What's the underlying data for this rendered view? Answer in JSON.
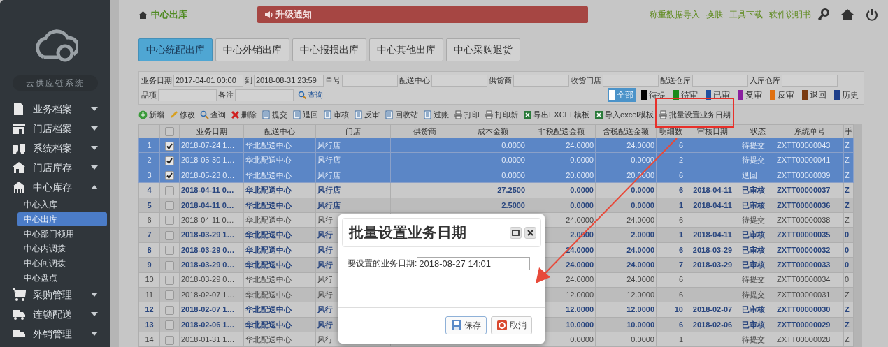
{
  "sidebar": {
    "title": "云供应链系统",
    "items": [
      {
        "label": "业务档案",
        "expanded": false
      },
      {
        "label": "门店档案",
        "expanded": false
      },
      {
        "label": "系统档案",
        "expanded": false
      },
      {
        "label": "门店库存",
        "expanded": false
      },
      {
        "label": "中心库存",
        "expanded": true,
        "children": [
          {
            "label": "中心入库",
            "selected": false
          },
          {
            "label": "中心出库",
            "selected": true
          },
          {
            "label": "中心部门领用",
            "selected": false
          },
          {
            "label": "中心内调拨",
            "selected": false
          },
          {
            "label": "中心间调拨",
            "selected": false
          },
          {
            "label": "中心盘点",
            "selected": false
          }
        ]
      },
      {
        "label": "采购管理",
        "expanded": false
      },
      {
        "label": "连锁配送",
        "expanded": false
      },
      {
        "label": "外销管理",
        "expanded": false
      }
    ]
  },
  "header": {
    "title": "中心出库",
    "notice": "升级通知",
    "links": [
      "称重数据导入",
      "换肤",
      "工具下载",
      "软件说明书"
    ]
  },
  "tabs": [
    {
      "label": "中心统配出库",
      "selected": true
    },
    {
      "label": "中心外销出库",
      "selected": false
    },
    {
      "label": "中心报损出库",
      "selected": false
    },
    {
      "label": "中心其他出库",
      "selected": false
    },
    {
      "label": "中心采购退货",
      "selected": false
    }
  ],
  "filters": {
    "fields": [
      {
        "label": "业务日期",
        "value": "2017-04-01 00:00"
      },
      {
        "label": "到",
        "value": "2018-08-31 23:59"
      },
      {
        "label": "单号"
      },
      {
        "label": "配送中心"
      },
      {
        "label": "供货商"
      },
      {
        "label": "收货门店"
      },
      {
        "label": "配送仓库"
      },
      {
        "label": "入库仓库"
      }
    ],
    "fields_2": [
      {
        "label": "品项"
      },
      {
        "label": "备注"
      }
    ],
    "query_button": "查询",
    "status_legend": [
      {
        "label": "全部",
        "color": "#ffffff",
        "selected": true
      },
      {
        "label": "待提",
        "color": "#000000",
        "selected": false
      },
      {
        "label": "待审",
        "color": "#1a8a1a",
        "selected": false
      },
      {
        "label": "已审",
        "color": "#1f4fa0",
        "selected": false
      },
      {
        "label": "复审",
        "color": "#8a1fa0",
        "selected": false
      },
      {
        "label": "反审",
        "color": "#e07010",
        "selected": false
      },
      {
        "label": "退回",
        "color": "#7a3a10",
        "selected": false
      },
      {
        "label": "历史",
        "color": "#1f3f8a",
        "selected": false
      }
    ]
  },
  "toolbar": [
    "新增",
    "修改",
    "查询",
    "删除",
    "提交",
    "退回",
    "审核",
    "反审",
    "回收站",
    "过账",
    "打印",
    "打印新",
    "导出EXCEL模板",
    "导入excel模板",
    "批量设置业务日期"
  ],
  "table": {
    "all_checked": false,
    "columns": [
      "业务日期",
      "配送中心",
      "门店",
      "供货商",
      "成本金额",
      "非税配送金额",
      "含税配送金额",
      "明细数",
      "审核日期",
      "状态",
      "系统单号",
      "手"
    ],
    "rows": [
      {
        "no": "1",
        "selected": true,
        "checked": true,
        "bold": false,
        "date": "2018-07-24 1…",
        "center": "华北配送中心",
        "store": "风行店",
        "cost": "0.0000",
        "nontax": "24.0000",
        "tax": "24.0000",
        "lines": "6",
        "status": "待提交",
        "doc_no": "ZXTT00000043",
        "column_12": "Z"
      },
      {
        "no": "2",
        "selected": true,
        "checked": true,
        "bold": false,
        "date": "2018-05-30 1…",
        "center": "华北配送中心",
        "store": "风行店",
        "cost": "0.0000",
        "nontax": "0.0000",
        "tax": "0.0000",
        "lines": "2",
        "status": "待提交",
        "doc_no": "ZXTT00000041",
        "column_12": "Z"
      },
      {
        "no": "3",
        "selected": true,
        "checked": true,
        "bold": false,
        "date": "2018-05-23 0…",
        "center": "华北配送中心",
        "store": "风行店",
        "cost": "0.0000",
        "nontax": "20.0000",
        "tax": "20.0000",
        "lines": "6",
        "status": "退回",
        "doc_no": "ZXTT00000039",
        "column_12": "Z"
      },
      {
        "no": "4",
        "selected": false,
        "checked": false,
        "bold": true,
        "date": "2018-04-11 0…",
        "center": "华北配送中心",
        "store": "风行店",
        "cost": "27.2500",
        "nontax": "0.0000",
        "tax": "0.0000",
        "lines": "6",
        "audit_date": "2018-04-11",
        "status": "已审核",
        "doc_no": "ZXTT00000037",
        "column_12": "Z"
      },
      {
        "no": "5",
        "selected": false,
        "checked": false,
        "bold": true,
        "date": "2018-04-11 0…",
        "center": "华北配送中心",
        "store": "风行店",
        "cost": "2.5000",
        "nontax": "0.0000",
        "tax": "0.0000",
        "lines": "1",
        "audit_date": "2018-04-11",
        "status": "已审核",
        "doc_no": "ZXTT00000036",
        "column_12": "Z"
      },
      {
        "no": "6",
        "selected": false,
        "checked": false,
        "bold": false,
        "date": "2018-04-11 0…",
        "center": "华北配送中心",
        "store": "风行",
        "nontax": "24.0000",
        "tax": "24.0000",
        "lines": "6",
        "status": "待提交",
        "doc_no": "ZXTT00000038",
        "column_12": "Z"
      },
      {
        "no": "7",
        "selected": false,
        "checked": false,
        "bold": true,
        "date": "2018-03-29 1…",
        "center": "华北配送中心",
        "store": "风行",
        "nontax": "2.0000",
        "tax": "2.0000",
        "lines": "1",
        "audit_date": "2018-04-11",
        "status": "已审核",
        "doc_no": "ZXTT00000035",
        "column_12": "0"
      },
      {
        "no": "8",
        "selected": false,
        "checked": false,
        "bold": true,
        "date": "2018-03-29 0…",
        "center": "华北配送中心",
        "store": "风行",
        "nontax": "24.0000",
        "tax": "24.0000",
        "lines": "6",
        "audit_date": "2018-03-29",
        "status": "已审核",
        "doc_no": "ZXTT00000032",
        "column_12": "0"
      },
      {
        "no": "9",
        "selected": false,
        "checked": false,
        "bold": true,
        "date": "2018-03-29 0…",
        "center": "华北配送中心",
        "store": "风行",
        "nontax": "24.0000",
        "tax": "24.0000",
        "lines": "7",
        "audit_date": "2018-03-29",
        "status": "已审核",
        "doc_no": "ZXTT00000033",
        "column_12": "0"
      },
      {
        "no": "10",
        "selected": false,
        "checked": false,
        "bold": false,
        "date": "2018-03-29 0…",
        "center": "华北配送中心",
        "store": "风行",
        "nontax": "24.0000",
        "tax": "24.0000",
        "lines": "6",
        "status": "待提交",
        "doc_no": "ZXTT00000034",
        "column_12": "0"
      },
      {
        "no": "11",
        "selected": false,
        "checked": false,
        "bold": false,
        "date": "2018-02-07 1…",
        "center": "华北配送中心",
        "store": "风行",
        "nontax": "12.0000",
        "tax": "12.0000",
        "lines": "6",
        "status": "待提交",
        "doc_no": "ZXTT00000031",
        "column_12": "Z"
      },
      {
        "no": "12",
        "selected": false,
        "checked": false,
        "bold": true,
        "date": "2018-02-07 1…",
        "center": "华北配送中心",
        "store": "风行",
        "nontax": "12.0000",
        "tax": "12.0000",
        "lines": "10",
        "audit_date": "2018-02-07",
        "status": "已审核",
        "doc_no": "ZXTT00000030",
        "column_12": "Z"
      },
      {
        "no": "13",
        "selected": false,
        "checked": false,
        "bold": true,
        "date": "2018-02-06 1…",
        "center": "华北配送中心",
        "store": "风行",
        "nontax": "10.0000",
        "tax": "10.0000",
        "lines": "6",
        "audit_date": "2018-02-06",
        "status": "已审核",
        "doc_no": "ZXTT00000029",
        "column_12": "Z"
      },
      {
        "no": "14",
        "selected": false,
        "checked": false,
        "bold": false,
        "date": "2018-01-31 1…",
        "center": "华北配送中心",
        "store": "风行",
        "nontax": "0.0000",
        "tax": "0.0000",
        "lines": "1",
        "status": "待提交",
        "doc_no": "ZXTT00000028",
        "column_12": "Z"
      }
    ]
  },
  "dialog": {
    "title": "批量设置业务日期",
    "field_label": "要设置的业务日期:",
    "field_value": "2018-08-27 14:01",
    "buttons": [
      {
        "label": "保存",
        "kind": "save"
      },
      {
        "label": "取消",
        "kind": "cancel"
      }
    ]
  }
}
